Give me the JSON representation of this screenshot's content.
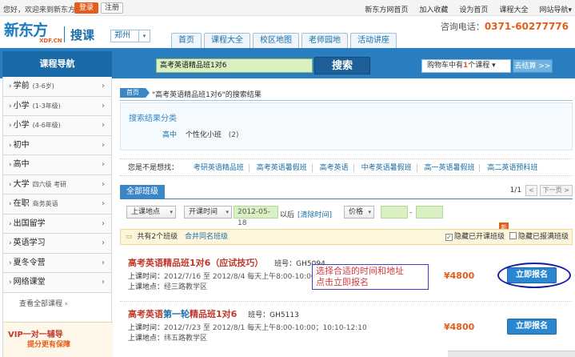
{
  "topbar": {
    "welcome": "您好，欢迎来到新东方",
    "login": "登录",
    "register": "注册",
    "links": [
      "新东方网首页",
      "加入收藏",
      "设为首页",
      "课程大全",
      "网站导航"
    ],
    "links_caret": "▾"
  },
  "header": {
    "logo_cn": "新东方",
    "logo_en": "XDF.CN",
    "brand": "搜课",
    "city": "郑州",
    "city_caret": "▾",
    "phone_label": "咨询电话：",
    "phone_number": "0371-60277776",
    "nav": [
      "首页",
      "课程大全",
      "校区地图",
      "老师园地",
      "活动讲座"
    ]
  },
  "search": {
    "category_header": "课程导航",
    "query": "高考英语精品班1对6",
    "button": "搜索",
    "cart_prefix": "购物车中有",
    "cart_count": "1",
    "cart_suffix": "个课程",
    "cart_caret": "▾",
    "checkout": "去结算 >>"
  },
  "sidebar": {
    "items": [
      {
        "label": "学前",
        "sub": "(3-6岁)"
      },
      {
        "label": "小学",
        "sub": "(1-3年级)"
      },
      {
        "label": "小学",
        "sub": "(4-6年级)"
      },
      {
        "label": "初中",
        "sub": ""
      },
      {
        "label": "高中",
        "sub": ""
      },
      {
        "label": "大学",
        "sub": "四六级  考研"
      },
      {
        "label": "在职",
        "sub": "商务英语"
      },
      {
        "label": "出国留学",
        "sub": ""
      },
      {
        "label": "英语学习",
        "sub": ""
      },
      {
        "label": "夏冬令营",
        "sub": ""
      },
      {
        "label": "网络课堂",
        "sub": ""
      }
    ],
    "more": "查看全部课程",
    "more_arrow": "›",
    "vip_title": "VIP一对一辅导",
    "vip_sub": "提分更有保障"
  },
  "main": {
    "crumb_home": "首页",
    "crumb_text": "\"高考英语精品班1对6\"的搜索结果",
    "category_title": "搜索结果分类",
    "category_level": "高中",
    "category_name": "个性化小班",
    "category_count": "(2)",
    "suggest_label": "您是不是想找：",
    "suggestions": [
      "考研英语精品班",
      "高考英语暑假班",
      "高考英语",
      "中考英语暑假班",
      "高一英语暑假班",
      "高二英语预科班"
    ],
    "tab_all": "全部班级",
    "pager_num": "1/1",
    "pager_prev": "<",
    "pager_next": "下一页 >",
    "filter_location": "上课地点",
    "filter_time": "开课时间",
    "filter_date": "2012-05-18",
    "filter_after": "以后",
    "filter_clear": "[清除时间]",
    "filter_price": "价格",
    "filter_dash": "-",
    "select_caret": "▾",
    "count_text": "共有2个班级",
    "merge_text": "合并同名班级",
    "hide_full": "隐藏已开课班级",
    "hide_closed": "隐藏已报满班级",
    "new_badge": "新",
    "check_mark": "✓",
    "fold_icon": "▭",
    "dot": "›",
    "arrow": "›"
  },
  "courses": [
    {
      "title_a": "高考英语精品班1对6",
      "title_b": "（应试技巧）",
      "cls_no": "班号：GH5094",
      "time_label": "上课时间：",
      "time_value": "2012/7/16 至 2012/8/4 每天上午8:00-10:00",
      "loc_label": "上课地点：",
      "loc_value": "经三路教学区",
      "price": "¥4800",
      "enroll": "立即报名"
    },
    {
      "title_a": "高考英语",
      "title_b": "第一轮",
      "title_c": "精品班1对6",
      "cls_no": "班号：GH5113",
      "time_label": "上课时间：",
      "time_value": "2012/7/23 至 2012/8/1 每天上午8:00-10:00；10:10-12:10",
      "loc_label": "上课地点：",
      "loc_value": "纬五路教学区",
      "price": "¥4800",
      "enroll": "立即报名"
    }
  ],
  "annotation": {
    "line1": "选择合适的时间和地址",
    "line2": "点击立即报名"
  },
  "colors": {
    "brand_blue": "#2a7dbf",
    "accent_orange": "#e45d1c",
    "title_red": "#c0392b"
  }
}
